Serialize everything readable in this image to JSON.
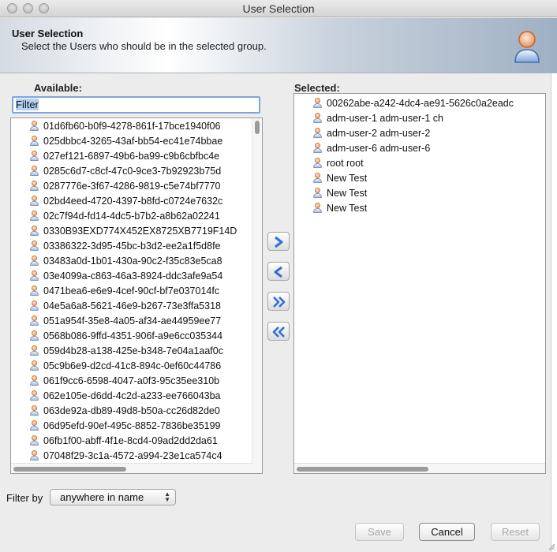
{
  "window": {
    "title": "User Selection"
  },
  "header": {
    "title": "User Selection",
    "subtitle": "Select the Users who should be in the selected group."
  },
  "available": {
    "label": "Available:",
    "filter_value": "Filter",
    "items": [
      "01d6fb60-b0f9-4278-861f-17bce1940f06",
      "025dbbc4-3265-43af-bb54-ec41e74bbae",
      "027ef121-6897-49b6-ba99-c9b6cbfbc4e",
      "0285c6d7-c8cf-47c0-9ce3-7b92923b75d",
      "0287776e-3f67-4286-9819-c5e74bf7770",
      "02bd4eed-4720-4397-b8fd-c0724e7632c",
      "02c7f94d-fd14-4dc5-b7b2-a8b62a02241",
      "0330B93EXD774X452EX8725XB7719F14D",
      "03386322-3d95-45bc-b3d2-ee2a1f5d8fe",
      "03483a0d-1b01-430a-90c2-f35c83e5ca8",
      "03e4099a-c863-46a3-8924-ddc3afe9a54",
      "0471bea6-e6e9-4cef-90cf-bf7e037014fc",
      "04e5a6a8-5621-46e9-b267-73e3ffa5318",
      "051a954f-35e8-4a05-af34-ae44959ee77",
      "0568b086-9ffd-4351-906f-a9e6cc035344",
      "059d4b28-a138-425e-b348-7e04a1aaf0c",
      "05c9b6e9-d2cd-41c8-894c-0ef60c44786",
      "061f9cc6-6598-4047-a0f3-95c35ee310b",
      "062e105e-d6dd-4c2d-a233-ee766043ba",
      "063de92a-db89-49d8-b50a-cc26d82de0",
      "06d95efd-90ef-495c-8852-7836be35199",
      "06fb1f00-abff-4f1e-8cd4-09ad2dd2da61",
      "07048f29-3c1a-4572-a994-23e1ca574c4"
    ]
  },
  "selected": {
    "label": "Selected:",
    "items": [
      "00262abe-a242-4dc4-ae91-5626c0a2eadc",
      "adm-user-1 adm-user-1 ch",
      "adm-user-2 adm-user-2",
      "adm-user-6 adm-user-6",
      "root root",
      "New Test",
      "New Test",
      "New Test"
    ]
  },
  "transfer_buttons": [
    "add-icon",
    "remove-icon",
    "add-all-icon",
    "remove-all-icon"
  ],
  "filter_by": {
    "label": "Filter by",
    "value": "anywhere in name"
  },
  "buttons": {
    "save": "Save",
    "cancel": "Cancel",
    "reset": "Reset"
  },
  "colors": {
    "accent": "#2f6fd6",
    "focus_ring": "#7ea7d8",
    "header_gradient_end": "#9fb0c3"
  }
}
